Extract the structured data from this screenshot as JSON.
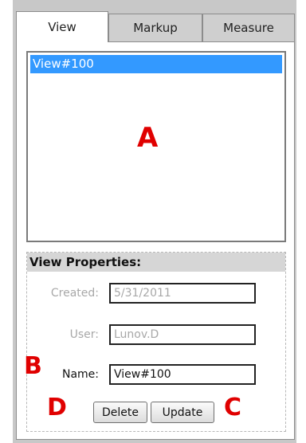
{
  "tabs": [
    {
      "label": "View",
      "active": true
    },
    {
      "label": "Markup",
      "active": false
    },
    {
      "label": "Measure",
      "active": false
    }
  ],
  "views_list": {
    "items": [
      {
        "label": "View#100",
        "selected": true
      }
    ]
  },
  "callouts": {
    "a": "A",
    "b": "B",
    "c": "C",
    "d": "D"
  },
  "properties": {
    "header": "View Properties:",
    "created_label": "Created:",
    "created_value": "5/31/2011",
    "user_label": "User:",
    "user_value": "Lunov.D",
    "name_label": "Name:",
    "name_value": "View#100",
    "delete_label": "Delete",
    "update_label": "Update"
  },
  "colors": {
    "selection": "#3399ff",
    "callout": "#e00000",
    "panel_bg": "#c8c8c8"
  }
}
